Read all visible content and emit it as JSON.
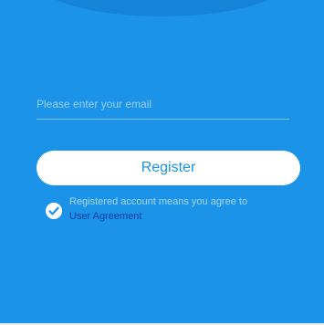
{
  "colors": {
    "background": "#1a93e8",
    "arc": "#1584d8",
    "button_background": "#ffffff",
    "button_text": "#1a93e8",
    "link": "#0d3f9c"
  },
  "form": {
    "email_placeholder": "Please enter your email",
    "email_value": ""
  },
  "register_button": {
    "label": "Register"
  },
  "agreement": {
    "checked": true,
    "checkbox_icon": "checkmark-icon",
    "text": "Registered account means you agree to",
    "link_label": "User Agreement"
  }
}
